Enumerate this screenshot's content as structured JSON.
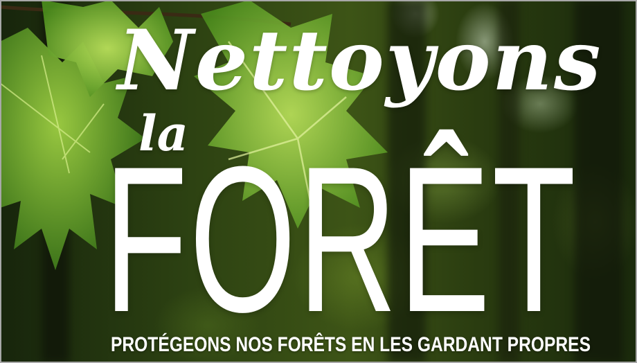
{
  "poster": {
    "title_script": "Nettoyons",
    "title_article": "la",
    "title_main": "FORÊT",
    "tagline": "PROTÉGEONS NOS FORÊTS EN LES GARDANT PROPRES"
  },
  "colors": {
    "text": "#ffffff",
    "leaf_light": "#8cc23a",
    "leaf_dark": "#3f7a1a",
    "forest_dark": "#17250c"
  },
  "icons": {
    "background": "maple-leaves-forest-photo"
  }
}
